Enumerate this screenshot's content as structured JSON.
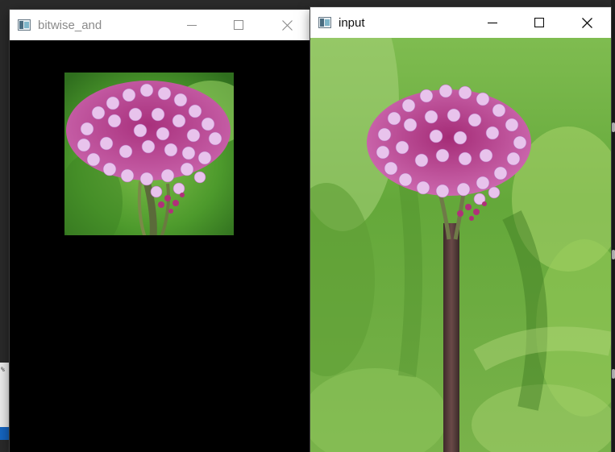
{
  "windows": [
    {
      "id": "bitwise_and",
      "title": "bitwise_and",
      "state": "inactive",
      "content": "masked image: flower crop visible inside rectangle, rest black",
      "controls": [
        "minimize-icon",
        "maximize-icon",
        "close-icon"
      ]
    },
    {
      "id": "input",
      "title": "input",
      "state": "active",
      "content": "photo of purple verbena flower on long stem with blurred green background",
      "controls": [
        "minimize-icon",
        "maximize-icon",
        "close-icon"
      ]
    }
  ],
  "colors": {
    "titlebar_bg": "#ffffff",
    "inactive_title": "#8a8a8a",
    "active_title": "#111111",
    "canvas_bg": "#000000",
    "flower_pink": "#d58fd6",
    "flower_magenta": "#b0307a",
    "leaf_green": "#5aa232",
    "stem_brown": "#5a3a38"
  }
}
